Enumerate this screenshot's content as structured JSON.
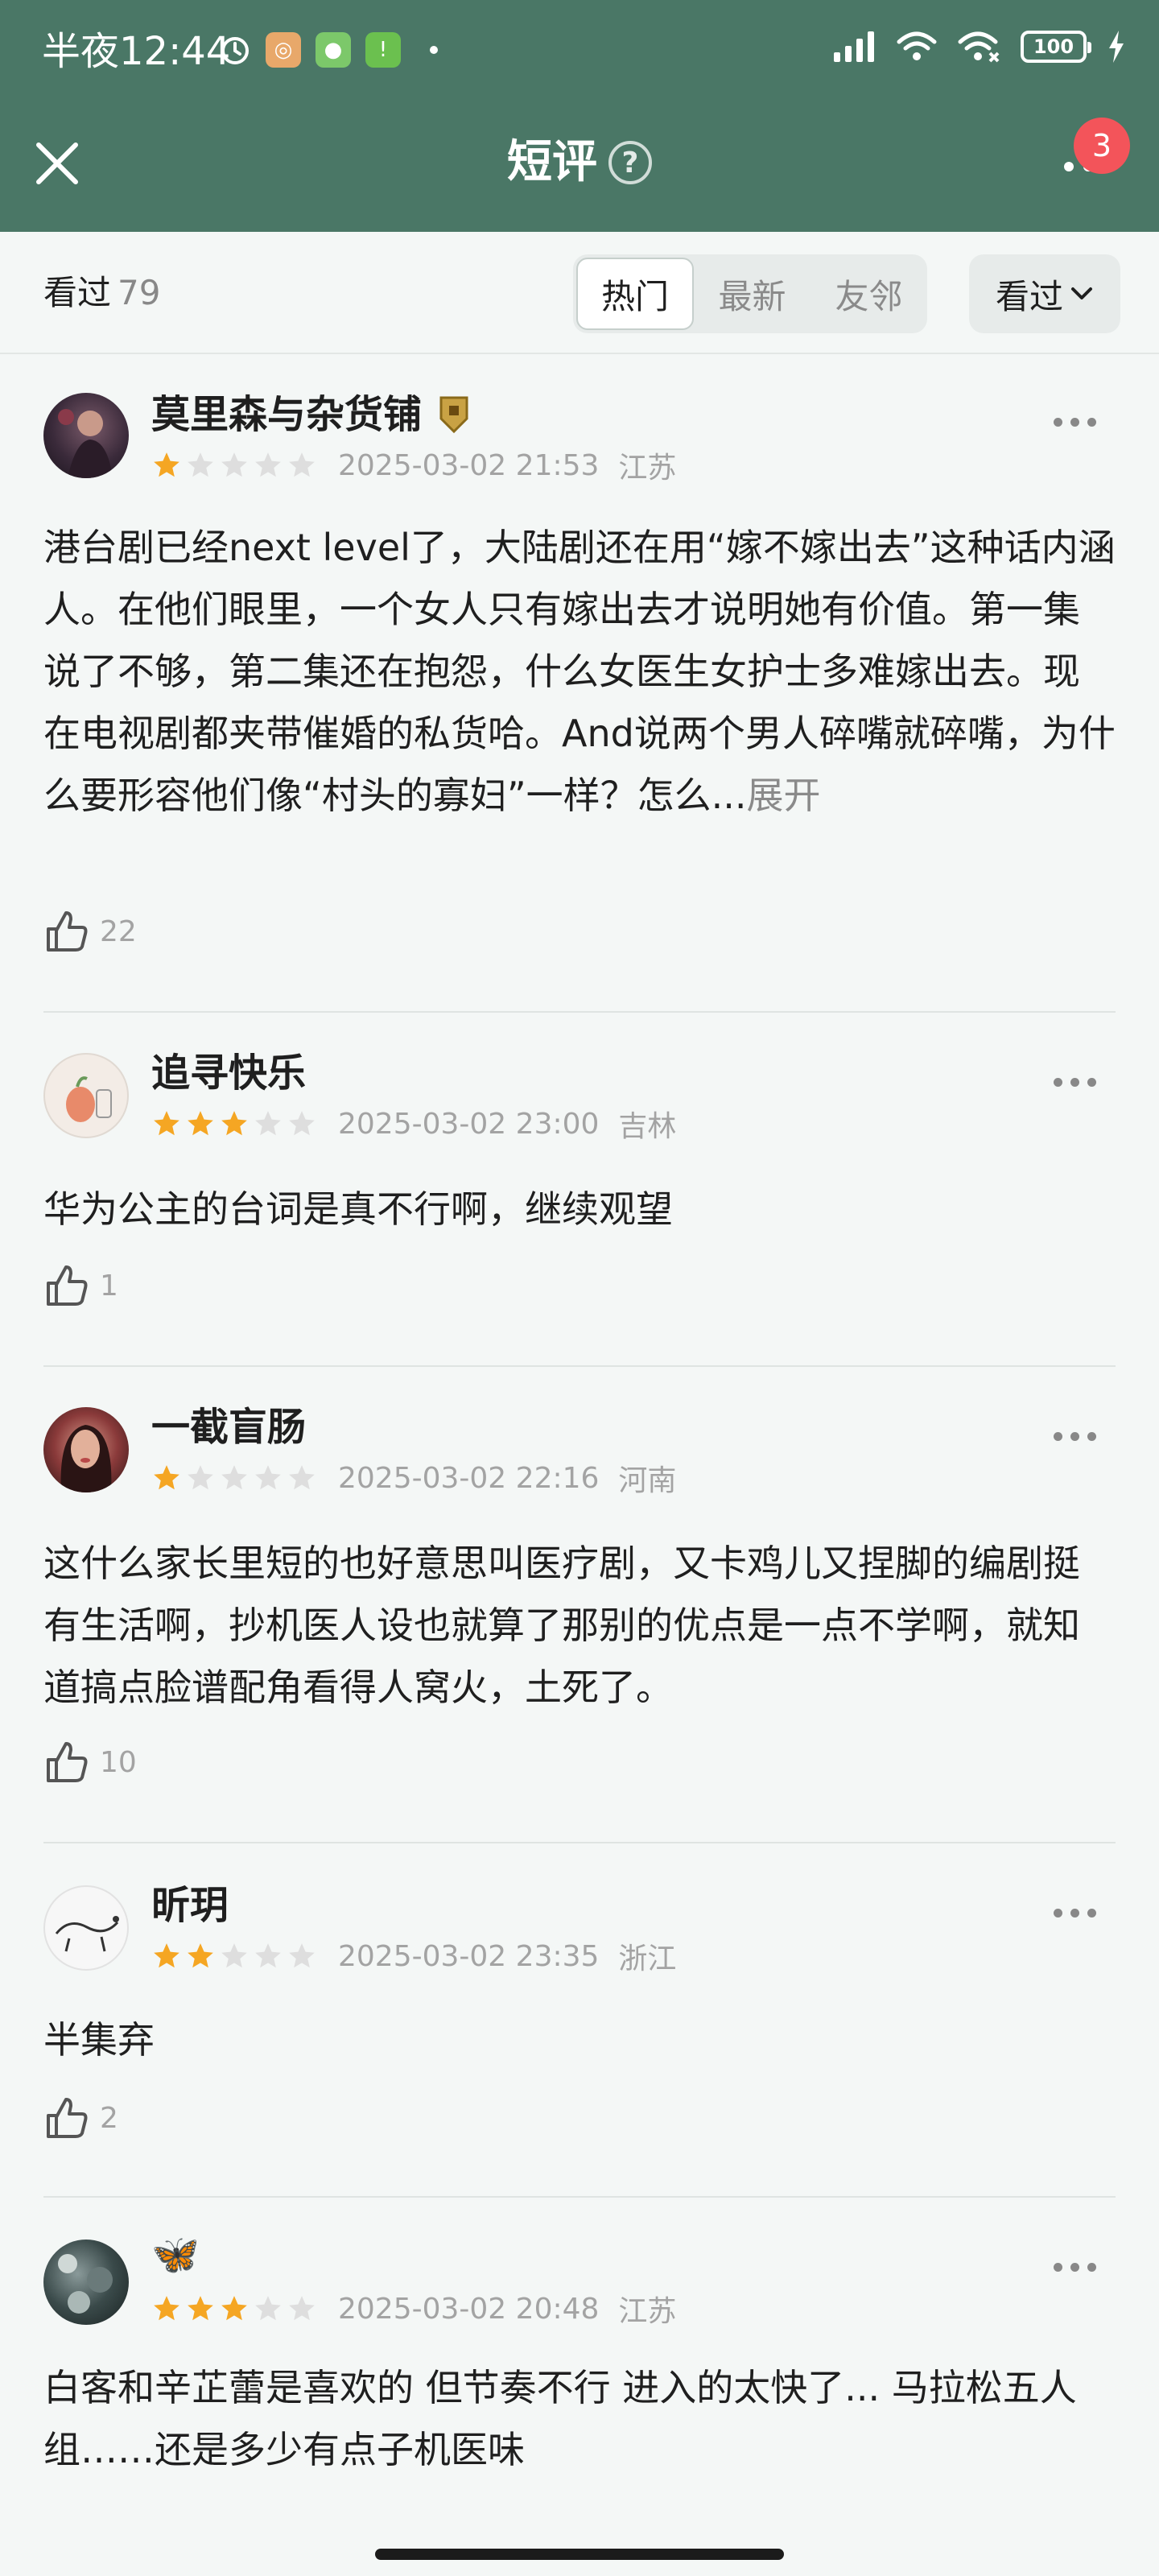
{
  "status_bar": {
    "time": "半夜12:44",
    "battery": "100"
  },
  "header": {
    "title": "短评",
    "help_glyph": "?",
    "badge": "3"
  },
  "filter": {
    "seen_label": "看过",
    "seen_count": "79",
    "tabs": [
      {
        "label": "热门",
        "active": true
      },
      {
        "label": "最新",
        "active": false
      },
      {
        "label": "友邻",
        "active": false
      }
    ],
    "dropdown": "看过"
  },
  "colors": {
    "header_green": "#4a7766",
    "star_filled": "#f5a623",
    "star_empty": "#dedede",
    "badge_red": "#f3545a"
  },
  "reviews": [
    {
      "user": "莫里森与杂货铺",
      "rating": 1,
      "time": "2025-03-02 21:53",
      "location": "江苏",
      "text": "港台剧已经next level了，大陆剧还在用“嫁不嫁出去”这种话内涵人。在他们眼里，一个女人只有嫁出去才说明她有价值。第一集说了不够，第二集还在抱怨，什么女医生女护士多难嫁出去。现在电视剧都夹带催婚的私货哈。And说两个男人碎嘴就碎嘴，为什么要形容他们像“村头的寡妇”一样？怎么...",
      "expand": "展开",
      "likes": "22"
    },
    {
      "user": "追寻快乐",
      "rating": 3,
      "time": "2025-03-02 23:00",
      "location": "吉林",
      "text": "华为公主的台词是真不行啊，继续观望",
      "likes": "1"
    },
    {
      "user": "一截盲肠",
      "rating": 1,
      "time": "2025-03-02 22:16",
      "location": "河南",
      "text": "这什么家长里短的也好意思叫医疗剧，又卡鸡儿又捏脚的编剧挺有生活啊，抄机医人设也就算了那别的优点是一点不学啊，就知道搞点脸谱配角看得人窝火，土死了。",
      "likes": "10"
    },
    {
      "user": "昕玥",
      "rating": 2,
      "time": "2025-03-02 23:35",
      "location": "浙江",
      "text": "半集弃",
      "likes": "2"
    },
    {
      "user": "🦋",
      "rating": 3,
      "time": "2025-03-02 20:48",
      "location": "江苏",
      "text": "白客和辛芷蕾是喜欢的 但节奏不行 进入的太快了... 马拉松五人组……还是多少有点子机医味"
    }
  ]
}
